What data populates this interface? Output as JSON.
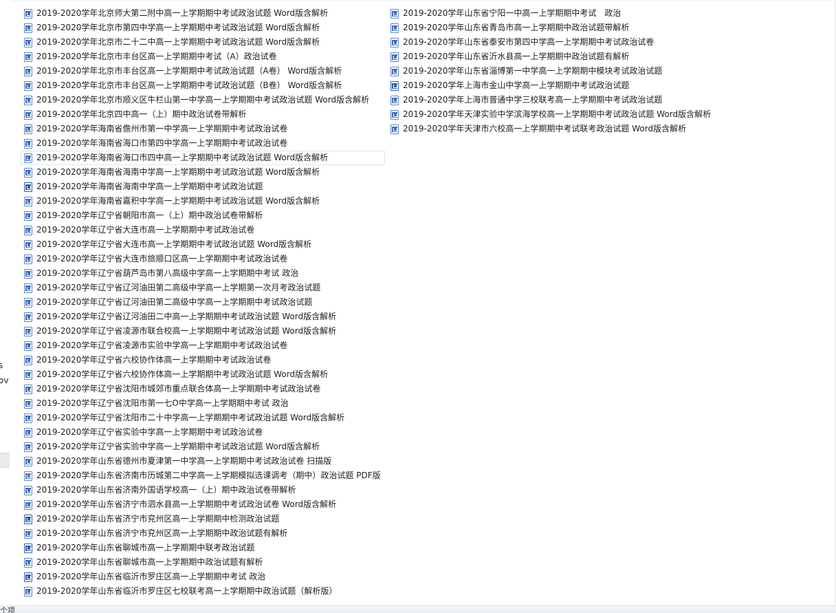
{
  "nav_pane": {
    "fragments": [
      "s",
      "ov"
    ]
  },
  "file_list": {
    "left_column": [
      {
        "name": "2019-2020学年北京师大第二附中高一上学期期中考试政治试题 Word版含解析",
        "icon": "word-doc-icon"
      },
      {
        "name": "2019-2020学年北京市第四中学高一上学期期中考试政治试题 Word版含解析",
        "icon": "word-doc-icon"
      },
      {
        "name": "2019-2020学年北京市二十二中高一上学期期中考试政治试题 Word版含解析",
        "icon": "word-doc-icon"
      },
      {
        "name": "2019-2020学年北京市丰台区高一上学期期中考试（A）政治试卷",
        "icon": "word-doc-icon"
      },
      {
        "name": "2019-2020学年北京市丰台区高一上学期期中考试政治试题（A卷） Word版含解析",
        "icon": "word-doc-icon"
      },
      {
        "name": "2019-2020学年北京市丰台区高一上学期期中考试政治试题（B卷） Word版含解析",
        "icon": "word-doc-icon"
      },
      {
        "name": "2019-2020学年北京市顺义区牛栏山第一中学高一上学期期中考试政治试题 Word版含解析",
        "icon": "word-doc-icon"
      },
      {
        "name": "2019-2020学年北京四中高一（上）期中政治试卷带解析",
        "icon": "word-doc-icon"
      },
      {
        "name": "2019-2020学年海南省儋州市第一中学高一上学期期中考试政治试卷",
        "icon": "word-doc-icon"
      },
      {
        "name": "2019-2020学年海南省海口市第四中学高一上学期期中考试政治试卷",
        "icon": "word-doc-icon"
      },
      {
        "name": "2019-2020学年海南省海口市四中高一上学期期中考试政治试题 Word版含解析",
        "icon": "word-doc-icon",
        "focused": true
      },
      {
        "name": "2019-2020学年海南省海南中学高一上学期期中考试政治试题 Word版含解析",
        "icon": "word-doc-icon"
      },
      {
        "name": "2019-2020学年海南省海南中学高一上学期期中考试政治试题",
        "icon": "word-doc-alt-icon"
      },
      {
        "name": "2019-2020学年海南省嘉积中学高一上学期期中考试政治试题 Word版含解析",
        "icon": "word-doc-icon"
      },
      {
        "name": "2019-2020学年辽宁省朝阳市高一（上）期中政治试卷带解析",
        "icon": "word-doc-icon"
      },
      {
        "name": "2019-2020学年辽宁省大连市高一上学期期中考试政治试卷",
        "icon": "word-doc-icon"
      },
      {
        "name": "2019-2020学年辽宁省大连市高一上学期期中考试政治试题 Word版含解析",
        "icon": "word-doc-icon"
      },
      {
        "name": "2019-2020学年辽宁省大连市旅顺口区高一上学期期中考试政治试卷",
        "icon": "word-doc-icon"
      },
      {
        "name": "2019-2020学年辽宁省葫芦岛市第八高级中学高一上学期期中考试 政治",
        "icon": "word-doc-icon"
      },
      {
        "name": "2019-2020学年辽宁省辽河油田第二高级中学高一上学期第一次月考政治试题",
        "icon": "word-doc-icon"
      },
      {
        "name": "2019-2020学年辽宁省辽河油田第二高级中学高一上学期期中考试政治试题",
        "icon": "word-doc-icon"
      },
      {
        "name": "2019-2020学年辽宁省辽河油田二中高一上学期期中考试政治试题 Word版含解析",
        "icon": "word-doc-icon"
      },
      {
        "name": "2019-2020学年辽宁省凌源市联合校高一上学期期中考试政治试题 Word版含解析",
        "icon": "word-doc-icon"
      },
      {
        "name": "2019-2020学年辽宁省凌源市实验中学高一上学期期中考试政治试卷",
        "icon": "word-doc-icon"
      },
      {
        "name": "2019-2020学年辽宁省六校协作体高一上学期期中考试政治试卷",
        "icon": "word-doc-icon"
      },
      {
        "name": "2019-2020学年辽宁省六校协作体高一上学期期中考试政治试题 Word版含解析",
        "icon": "word-doc-icon"
      },
      {
        "name": "2019-2020学年辽宁省沈阳市城郊市重点联合体高一上学期期中考试政治试卷",
        "icon": "word-doc-icon"
      },
      {
        "name": "2019-2020学年辽宁省沈阳市第一七O中学高一上学期期中考试 政治",
        "icon": "word-doc-icon"
      },
      {
        "name": "2019-2020学年辽宁省沈阳市二十中学高一上学期期中考试政治试题 Word版含解析",
        "icon": "word-doc-icon"
      },
      {
        "name": "2019-2020学年辽宁省实验中学高一上学期期中考试政治试卷",
        "icon": "word-doc-icon"
      },
      {
        "name": "2019-2020学年辽宁省实验中学高一上学期期中考试政治试题 Word版含解析",
        "icon": "word-doc-icon"
      },
      {
        "name": "2019-2020学年山东省德州市夏津第一中学高一上学期期中考试政治试卷 扫描版",
        "icon": "word-doc-icon"
      },
      {
        "name": "2019-2020学年山东省济南市历城第二中学高一上学期模拟选课调考（期中）政治试题 PDF版",
        "icon": "pdf-doc-icon"
      },
      {
        "name": "2019-2020学年山东省济南外国语学校高一（上）期中政治试卷带解析",
        "icon": "word-doc-icon"
      },
      {
        "name": "2019-2020学年山东省济宁市泗水县高一上学期期中考试政治试卷 Word版含解析",
        "icon": "word-doc-icon"
      },
      {
        "name": "2019-2020学年山东省济宁市兖州区高一上学期期中检测政治试题",
        "icon": "word-doc-alt-icon"
      },
      {
        "name": "2019-2020学年山东省济宁市兖州区高一上学期期中政治试题有解析",
        "icon": "word-doc-icon"
      },
      {
        "name": "2019-2020学年山东省聊城市高一上学期期中联考政治试题",
        "icon": "word-doc-alt-icon"
      },
      {
        "name": "2019-2020学年山东省聊城市高一上学期期中政治试题有解析",
        "icon": "word-doc-icon"
      },
      {
        "name": "2019-2020学年山东省临沂市罗庄区高一上学期期中考试 政治",
        "icon": "word-doc-alt-icon"
      },
      {
        "name": "2019-2020学年山东省临沂市罗庄区七校联考高一上学期期中政治试题（解析版）",
        "icon": "word-doc-icon"
      }
    ],
    "right_column": [
      {
        "name": "2019-2020学年山东省宁阳一中高一上学期期中考试　政治",
        "icon": "word-doc-icon"
      },
      {
        "name": "2019-2020学年山东省青岛市高一上学期期中政治试题带解析",
        "icon": "word-doc-icon"
      },
      {
        "name": "2019-2020学年山东省泰安市第四中学高一上学期期中考试政治试卷",
        "icon": "word-doc-icon"
      },
      {
        "name": "2019-2020学年山东省沂水县高一上学期期中政治试题有解析",
        "icon": "word-doc-icon"
      },
      {
        "name": "2019-2020学年山东省淄博第一中学高一上学期期中模块考试政治试题",
        "icon": "word-doc-icon"
      },
      {
        "name": "2019-2020学年上海市金山中学高一上学期期中考试政治试题",
        "icon": "word-doc-alt-icon"
      },
      {
        "name": "2019-2020学年上海市普通中学三校联考高一上学期期中考试政治试题",
        "icon": "word-doc-icon"
      },
      {
        "name": "2019-2020学年天津实验中学滨海学校高一上学期期中考试政治试题 Word版含解析",
        "icon": "word-doc-icon"
      },
      {
        "name": "2019-2020学年天津市六校高一上学期期中考试联考政治试题 Word版含解析",
        "icon": "word-doc-icon"
      }
    ]
  },
  "status_bar": {
    "text": "个项"
  },
  "colors": {
    "icon_blue": "#3d6fbf",
    "focus_border": "#d9e6f5",
    "text": "#1e1e1e"
  }
}
